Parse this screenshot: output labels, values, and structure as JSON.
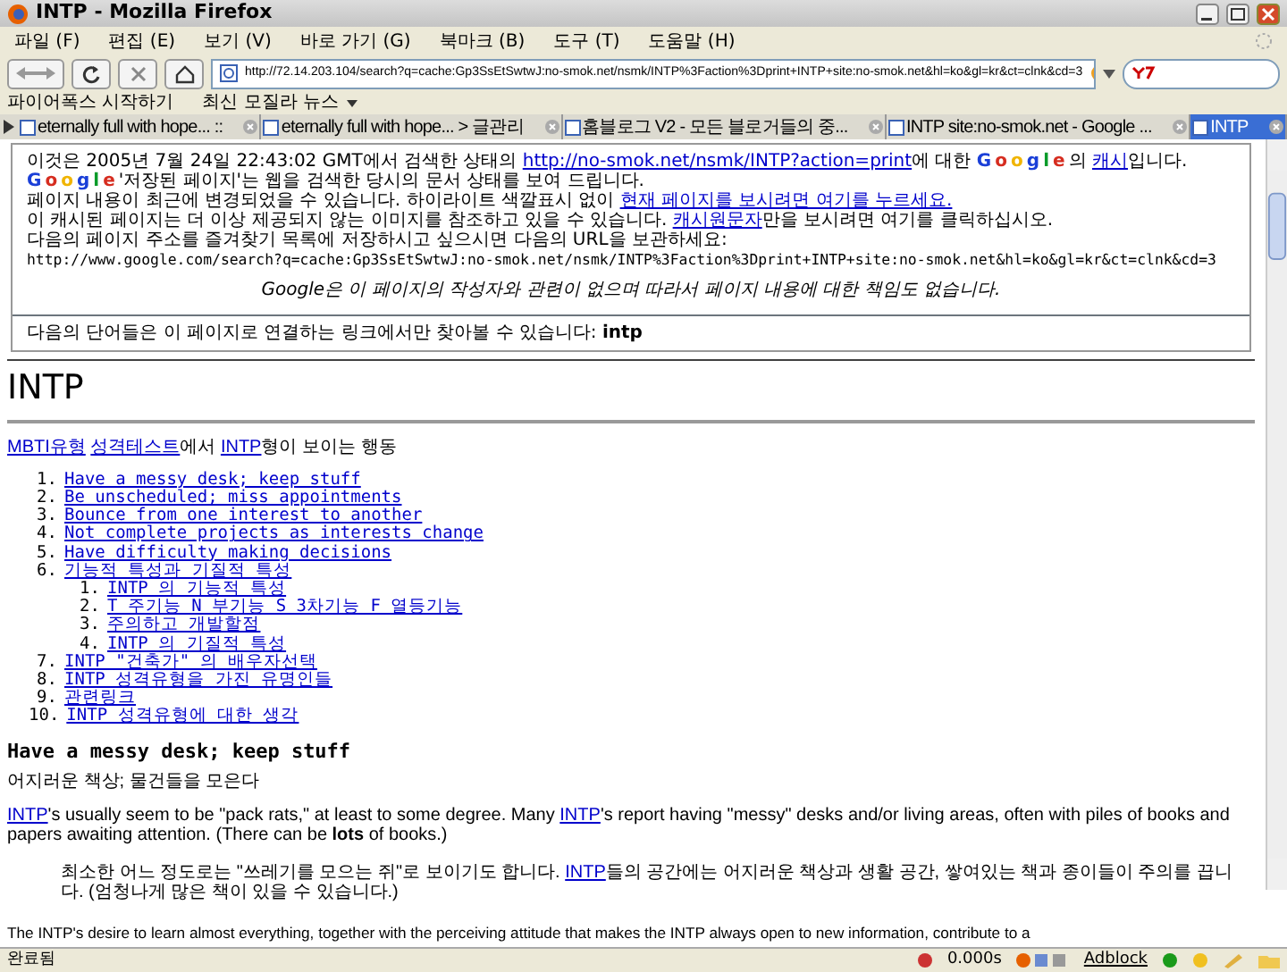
{
  "window": {
    "title": "INTP - Mozilla Firefox"
  },
  "menu": [
    "파일 (F)",
    "편집 (E)",
    "보기 (V)",
    "바로 가기 (G)",
    "북마크 (B)",
    "도구 (T)",
    "도움말 (H)"
  ],
  "address": {
    "value": "http://72.14.203.104/search?q=cache:Gp3SsEtSwtwJ:no-smok.net/nsmk/INTP%3Faction%3Dprint+INTP+site:no-smok.net&hl=ko&gl=kr&ct=clnk&cd=3"
  },
  "bookmarks": [
    {
      "label": "파이어폭스 시작하기",
      "folder": false
    },
    {
      "label": "최신 모질라 뉴스",
      "folder": true
    }
  ],
  "tabs": [
    {
      "label": "eternally full with hope... ::",
      "selected": false
    },
    {
      "label": "eternally full with hope... > 글관리",
      "selected": false
    },
    {
      "label": "홈블로그 V2 - 모든 블로거들의 중...",
      "selected": false
    },
    {
      "label": "INTP site:no-smok.net - Google ...",
      "selected": false
    },
    {
      "label": "INTP",
      "selected": true
    }
  ],
  "cache_notice": {
    "lines": [
      [
        {
          "kind": "text",
          "text": "이것은 2005년 7월 24일 22:43:02 GMT에서 검색한 상태의 "
        },
        {
          "kind": "link",
          "text": "http://no-smok.net/nsmk/INTP?action=print"
        },
        {
          "kind": "text",
          "text": "에 대한 "
        },
        {
          "kind": "logo",
          "text": "Google"
        },
        {
          "kind": "text",
          "text": "의 "
        },
        {
          "kind": "link",
          "text": "캐시"
        },
        {
          "kind": "text",
          "text": "입니다."
        }
      ],
      [
        {
          "kind": "logo",
          "text": "Google"
        },
        {
          "kind": "text",
          "text": "'저장된 페이지'는 웹을 검색한 당시의 문서 상태를 보여 드립니다."
        }
      ],
      [
        {
          "kind": "text",
          "text": "페이지 내용이 최근에 변경되었을 수 있습니다. 하이라이트 색깔표시 없이 "
        },
        {
          "kind": "link",
          "text": "현재 페이지를 보시려면 여기를 누르세요."
        }
      ],
      [
        {
          "kind": "text",
          "text": "이 캐시된 페이지는 더 이상 제공되지 않는 이미지를 참조하고 있을 수 있습니다. "
        },
        {
          "kind": "link",
          "text": "캐시원문자"
        },
        {
          "kind": "text",
          "text": "만을 보시려면 여기를 클릭하십시오."
        }
      ],
      [
        {
          "kind": "text",
          "text": "다음의 페이지 주소를 즐겨찾기 목록에 저장하시고 싶으시면 다음의 URL을 보관하세요:"
        }
      ]
    ],
    "url": "http://www.google.com/search?q=cache:Gp3SsEtSwtwJ:no-smok.net/nsmk/INTP%3Faction%3Dprint+INTP+site:no-smok.net&hl=ko&gl=kr&ct=clnk&cd=3",
    "disclaimer": "Google은 이 페이지의 작성자와 관련이 없으며 따라서 페이지 내용에 대한 책임도 없습니다.",
    "terms": "다음의 단어들은 이 페이지로 연결하는 링크에서만 찾아볼 수 있습니다: **intp**"
  },
  "page": {
    "title": "INTP",
    "intro": [
      {
        "kind": "link",
        "text": "MBTI유형"
      },
      {
        "kind": "link",
        "text": "성격테스트"
      },
      {
        "kind": "text",
        "text": "에서 "
      },
      {
        "kind": "link",
        "text": "INTP"
      },
      {
        "kind": "text",
        "text": "형이 보이는 행동"
      }
    ],
    "toc": [
      {
        "number": "1.",
        "label": "Have a messy desk; keep stuff"
      },
      {
        "number": "2.",
        "label": "Be unscheduled; miss appointments"
      },
      {
        "number": "3.",
        "label": "Bounce from one interest to another"
      },
      {
        "number": "4.",
        "label": "Not complete projects as interests change"
      },
      {
        "number": "5.",
        "label": "Have difficulty making decisions"
      },
      {
        "number": "6.",
        "label": "기능적 특성과 기질적 특성",
        "children": [
          {
            "number": "1.",
            "label": "INTP 의 기능적 특성"
          },
          {
            "number": "2.",
            "label": "T 주기능 N 부기능 S 3차기능 F 열등기능"
          },
          {
            "number": "3.",
            "label": "주의하고 개발할점"
          },
          {
            "number": "4.",
            "label": "INTP 의 기질적 특성"
          }
        ]
      },
      {
        "number": "7.",
        "label": "INTP \"건축가\" 의 배우자선택"
      },
      {
        "number": "8.",
        "label": "INTP 성격유형을 가진 유명인들"
      },
      {
        "number": "9.",
        "label": "관련링크"
      },
      {
        "number": "10.",
        "label": "INTP 성격유형에 대한 생각"
      }
    ],
    "section_title": "Have a messy desk; keep stuff",
    "section_subtitle": "어지러운 책상; 물건들을 모은다",
    "paragraph": [
      {
        "kind": "link",
        "text": "INTP"
      },
      {
        "kind": "text",
        "text": "'s usually seem to be \"pack rats,\" at least to some degree. Many "
      },
      {
        "kind": "link",
        "text": "INTP"
      },
      {
        "kind": "text",
        "text": "'s report having \"messy\" desks and/or living areas, often with piles of books and papers awaiting attention. (There can be **lots** of books.)"
      }
    ],
    "quote": [
      {
        "kind": "text",
        "text": "최소한 어느 정도로는 \"쓰레기를 모으는 쥐\"로 보이기도 합니다. "
      },
      {
        "kind": "link",
        "text": "INTP"
      },
      {
        "kind": "text",
        "text": "들의 공간에는 어지러운 책상과 생활 공간, 쌓여있는 책과 종이들이 주의를 끕니다. (엄청나게 많은 책이 있을 수 있습니다.)"
      }
    ],
    "cut_line": "The INTP's desire to learn almost everything, together with the perceiving attitude that makes the INTP always open to new information, contribute to a"
  },
  "status_bar": {
    "text": "완료됨",
    "timer": "0.000s",
    "adblock": "Adblock"
  }
}
